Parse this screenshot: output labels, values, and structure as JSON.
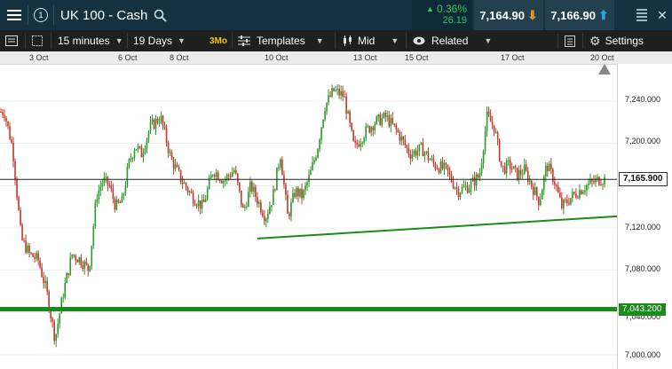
{
  "header": {
    "instrument": "UK 100 - Cash",
    "change_pct": "0.36%",
    "change_pts": "26.19",
    "sell_price": "7,164.90",
    "buy_price": "7,166.90",
    "accent_green": "#34c759",
    "sell_color": "#e0922a",
    "buy_color": "#2aa0e0"
  },
  "toolbar": {
    "interval": "15 minutes",
    "range": "19 Days",
    "range_badge": "3Mo",
    "templates": "Templates",
    "price_type": "Mid",
    "related": "Related",
    "settings": "Settings"
  },
  "dates": [
    "3 Oct",
    "6 Oct",
    "8 Oct",
    "10 Oct",
    "13 Oct",
    "15 Oct",
    "17 Oct",
    "20 Oct"
  ],
  "chart_data": {
    "type": "candlestick",
    "y_ticks": [
      "7,240.000",
      "7,200.000",
      "7,160.000",
      "7,120.000",
      "7,080.000",
      "7,040.000",
      "7,000.000"
    ],
    "ylim": [
      7000,
      7260
    ],
    "current_price": "7,165.900",
    "support_level": "7,043.200",
    "up_color": "#2a9a2a",
    "down_color": "#c0392b",
    "trendline": {
      "from": {
        "date": "10 Oct",
        "y": 7110
      },
      "to": {
        "date": "20 Oct",
        "y": 7131
      }
    },
    "path": [
      [
        "3 Oct",
        7230
      ],
      [
        "3 Oct",
        7195
      ],
      [
        "3 Oct",
        7110
      ],
      [
        "3 Oct",
        7095
      ],
      [
        "3 Oct",
        7090
      ],
      [
        "3 Oct",
        7060
      ],
      [
        "3 Oct",
        7015
      ],
      [
        "3 Oct",
        7060
      ],
      [
        "3 Oct",
        7095
      ],
      [
        "3 Oct",
        7090
      ],
      [
        "3 Oct",
        7080
      ],
      [
        "6 Oct",
        7150
      ],
      [
        "6 Oct",
        7165
      ],
      [
        "6 Oct",
        7160
      ],
      [
        "6 Oct",
        7140
      ],
      [
        "6 Oct",
        7145
      ],
      [
        "6 Oct",
        7180
      ],
      [
        "6 Oct",
        7198
      ],
      [
        "6 Oct",
        7190
      ],
      [
        "8 Oct",
        7215
      ],
      [
        "8 Oct",
        7225
      ],
      [
        "8 Oct",
        7185
      ],
      [
        "8 Oct",
        7165
      ],
      [
        "8 Oct",
        7150
      ],
      [
        "8 Oct",
        7140
      ],
      [
        "8 Oct",
        7175
      ],
      [
        "8 Oct",
        7165
      ],
      [
        "8 Oct",
        7175
      ],
      [
        "10 Oct",
        7135
      ],
      [
        "10 Oct",
        7160
      ],
      [
        "10 Oct",
        7145
      ],
      [
        "10 Oct",
        7130
      ],
      [
        "10 Oct",
        7150
      ],
      [
        "10 Oct",
        7190
      ],
      [
        "10 Oct",
        7130
      ],
      [
        "10 Oct",
        7155
      ],
      [
        "10 Oct",
        7150
      ],
      [
        "10 Oct",
        7170
      ],
      [
        "10 Oct",
        7195
      ],
      [
        "10 Oct",
        7235
      ],
      [
        "13 Oct",
        7250
      ],
      [
        "13 Oct",
        7245
      ],
      [
        "13 Oct",
        7195
      ],
      [
        "13 Oct",
        7210
      ],
      [
        "13 Oct",
        7220
      ],
      [
        "15 Oct",
        7225
      ],
      [
        "15 Oct",
        7210
      ],
      [
        "15 Oct",
        7190
      ],
      [
        "15 Oct",
        7195
      ],
      [
        "15 Oct",
        7180
      ],
      [
        "15 Oct",
        7175
      ],
      [
        "15 Oct",
        7155
      ],
      [
        "15 Oct",
        7160
      ],
      [
        "17 Oct",
        7170
      ],
      [
        "17 Oct",
        7225
      ],
      [
        "17 Oct",
        7215
      ],
      [
        "17 Oct",
        7175
      ],
      [
        "17 Oct",
        7180
      ],
      [
        "17 Oct",
        7170
      ],
      [
        "17 Oct",
        7175
      ],
      [
        "17 Oct",
        7160
      ],
      [
        "17 Oct",
        7145
      ],
      [
        "17 Oct",
        7180
      ],
      [
        "17 Oct",
        7165
      ],
      [
        "17 Oct",
        7140
      ],
      [
        "20 Oct",
        7150
      ],
      [
        "20 Oct",
        7160
      ],
      [
        "20 Oct",
        7166
      ]
    ]
  }
}
